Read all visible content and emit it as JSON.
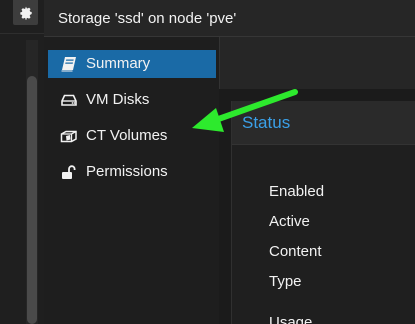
{
  "header": {
    "title": "Storage 'ssd' on node 'pve'"
  },
  "nav": {
    "items": [
      {
        "label": "Summary",
        "icon": "book-icon",
        "selected": true
      },
      {
        "label": "VM Disks",
        "icon": "hdd-icon",
        "selected": false
      },
      {
        "label": "CT Volumes",
        "icon": "cube-icon",
        "selected": false
      },
      {
        "label": "Permissions",
        "icon": "unlock-icon",
        "selected": false
      }
    ]
  },
  "status_panel": {
    "title": "Status",
    "rows": [
      "Enabled",
      "Active",
      "Content",
      "Type",
      "Usage"
    ]
  },
  "colors": {
    "accent": "#1a6aa6",
    "panel_title": "#3aa0e8",
    "annotation_arrow": "#2dea2d"
  }
}
